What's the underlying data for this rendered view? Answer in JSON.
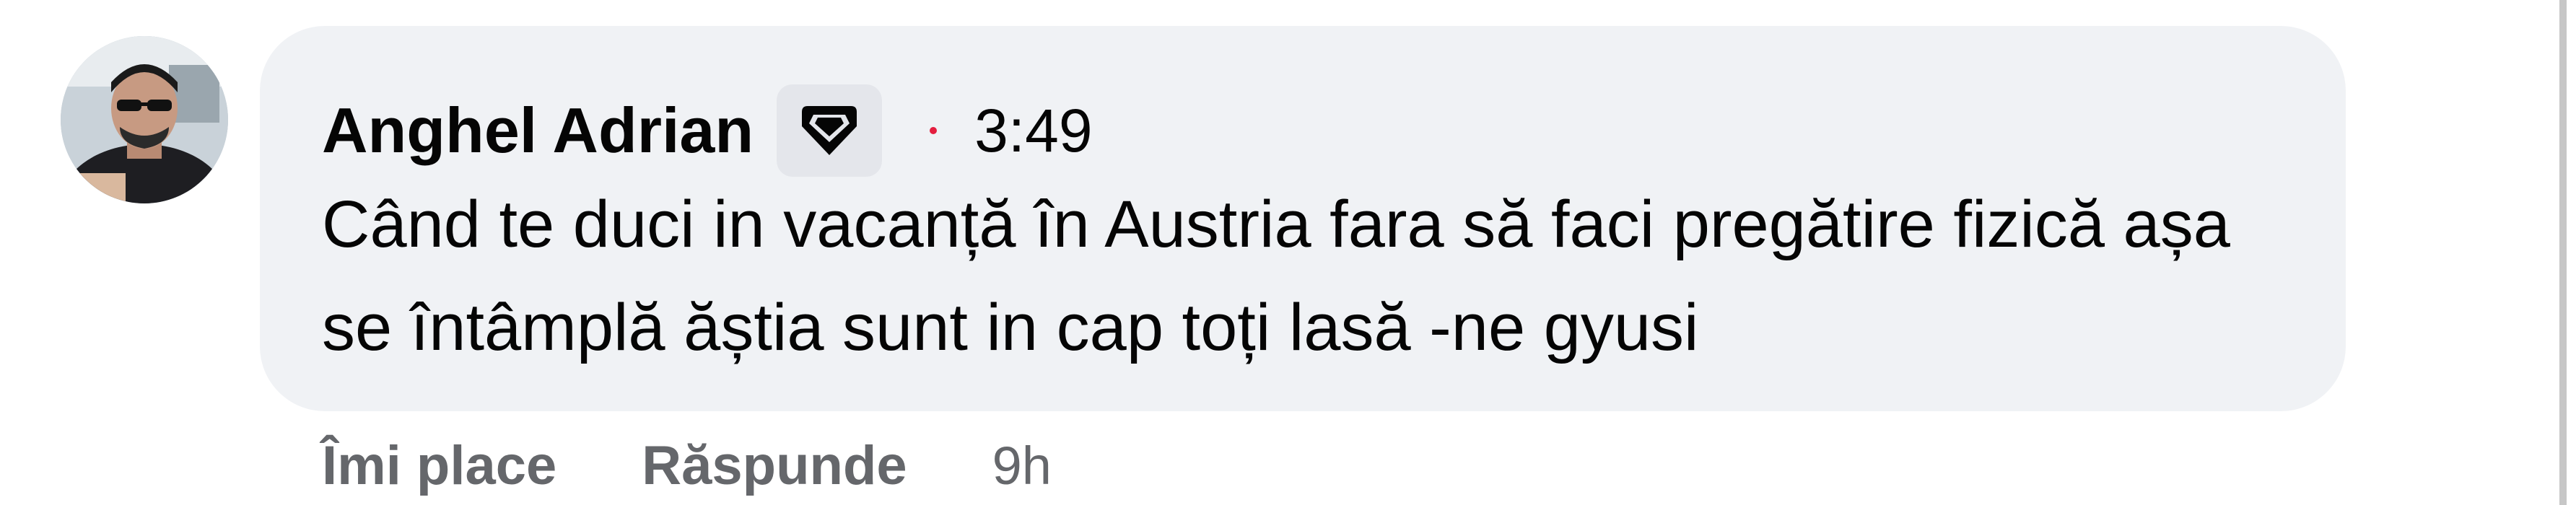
{
  "comment": {
    "author": "Anghel Adrian",
    "badge_icon": "top-fan-badge-icon",
    "time": "3:49",
    "text": "Când te duci in vacanță în Austria fara să faci pregătire fizică așa se întâmplă ăștia sunt in cap toți lasă -ne gyusi"
  },
  "actions": {
    "like_label": "Îmi place",
    "reply_label": "Răspunde",
    "age": "9h"
  },
  "colors": {
    "bubble_background": "#f0f2f5",
    "badge_background": "#e4e6eb",
    "dot": "#e41e3f",
    "action_text": "#65676b",
    "primary_text": "#050505"
  }
}
